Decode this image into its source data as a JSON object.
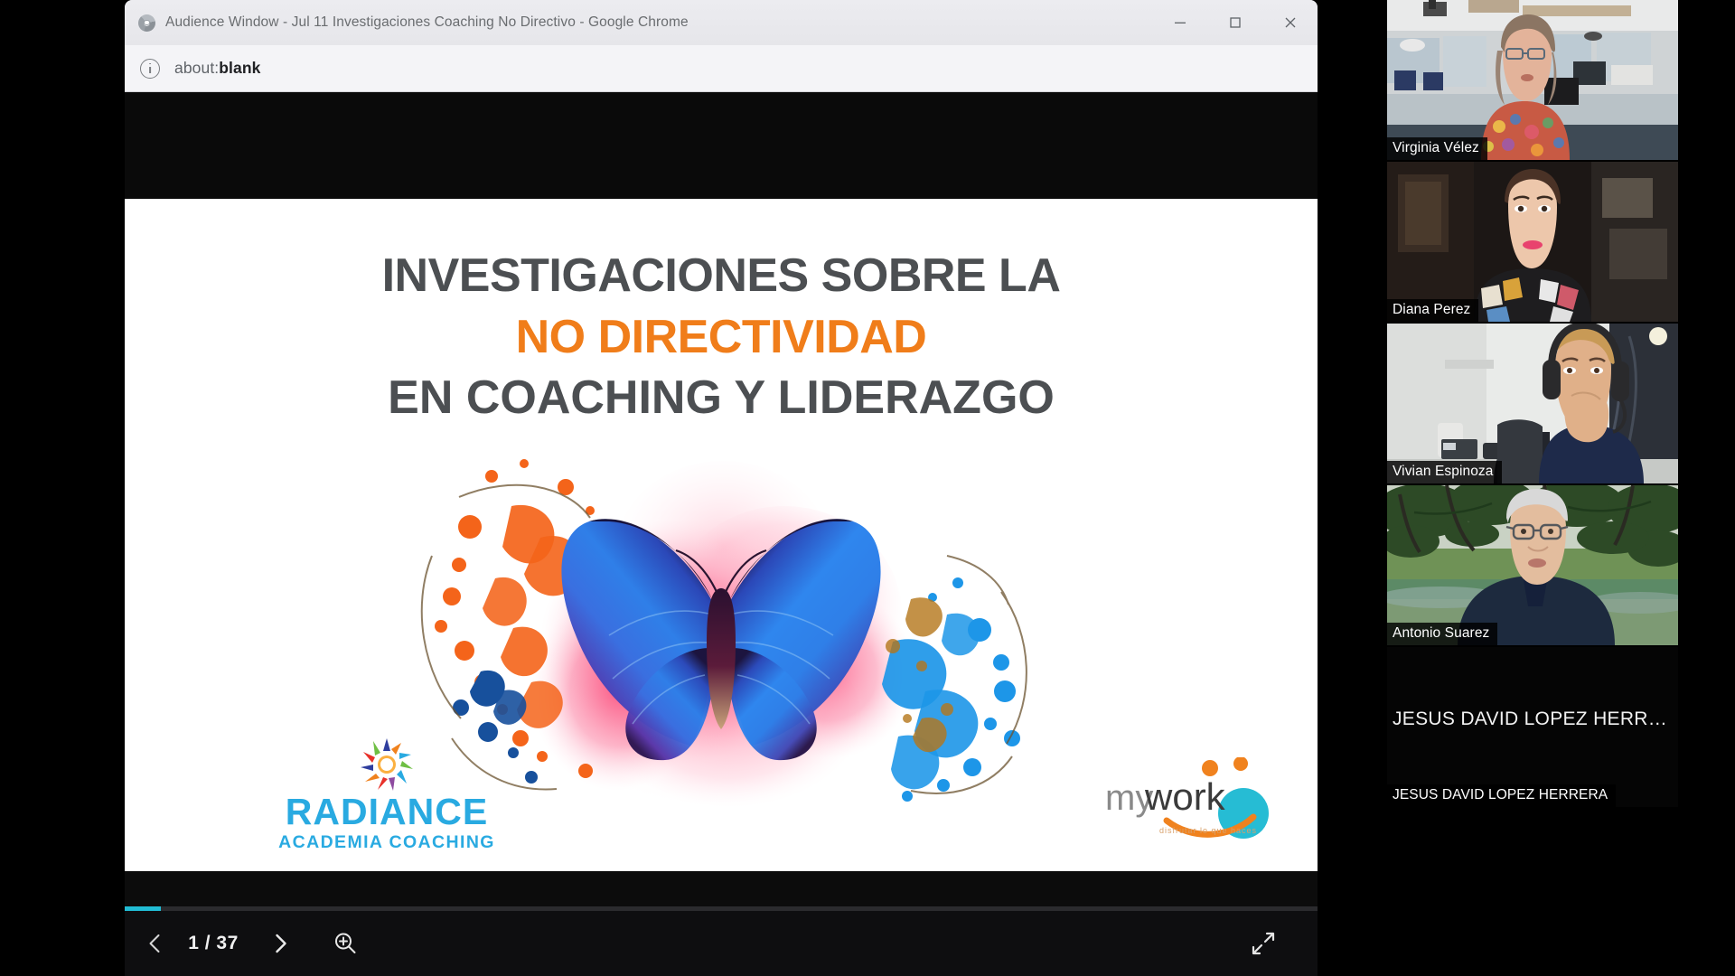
{
  "window": {
    "title": "Audience Window - Jul 11 Investigaciones Coaching No Directivo - Google Chrome",
    "favicon_name": "chrome-globe-icon",
    "controls": {
      "minimize_label": "Minimize",
      "maximize_label": "Maximize",
      "close_label": "Close"
    }
  },
  "omnibox": {
    "info_icon": "info-circle-icon",
    "url_prefix": "about:",
    "url_suffix": "blank",
    "url_full": "about:blank"
  },
  "slide": {
    "title_line1": "INVESTIGACIONES SOBRE LA",
    "title_line2": "NO DIRECTIVIDAD",
    "title_line3": "EN COACHING Y LIDERAZGO",
    "title_color_default": "#4c4f52",
    "title_color_accent": "#f07d1a",
    "artwork_name": "watercolor-butterfly-illustration",
    "logo_left_main": "RADIANCE",
    "logo_left_sub": "ACADEMIA COACHING",
    "logo_left_color": "#29aae1",
    "logo_right_text": "mywork",
    "logo_right_tagline": "disfrutar lo que haces",
    "logo_right_accent": "#f0821e",
    "logo_right_circle": "#26bcd4"
  },
  "pdf_toolbar": {
    "prev_icon": "chevron-left-icon",
    "next_icon": "chevron-right-icon",
    "page_indicator": "1 / 37",
    "current_page": 1,
    "total_pages": 37,
    "zoom_in_icon": "zoom-in-magnifier-icon",
    "fullscreen_icon": "expand-arrows-icon",
    "progress_percent": 3,
    "progress_color": "#21bcd4"
  },
  "video_rail": {
    "participants": [
      {
        "name": "Virginia Vélez",
        "camera_on": true
      },
      {
        "name": "Diana Perez",
        "camera_on": true
      },
      {
        "name": "Vivian Espinoza",
        "camera_on": true
      },
      {
        "name": "Antonio Suarez",
        "camera_on": true
      },
      {
        "name": "JESUS DAVID LOPEZ HERRERA",
        "display_name_truncated": "JESUS DAVID LOPEZ HERRE…",
        "camera_on": false
      }
    ]
  }
}
